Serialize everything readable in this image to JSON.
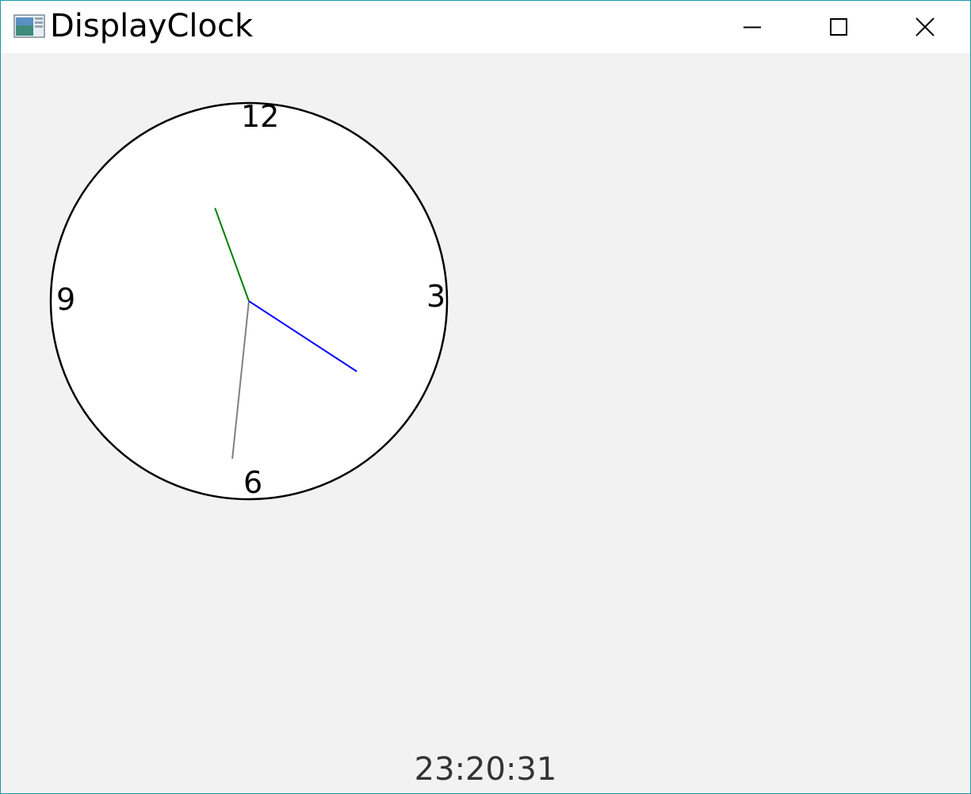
{
  "window": {
    "title": "DisplayClock",
    "frame_color": "#1c97a8"
  },
  "titlebar_buttons": {
    "minimize_icon": "minimize-icon",
    "maximize_icon": "maximize-icon",
    "close_icon": "close-icon"
  },
  "clock": {
    "numbers": {
      "twelve": "12",
      "three": "3",
      "six": "6",
      "nine": "9"
    },
    "hour": 23,
    "minute": 20,
    "second": 31,
    "hour_hand_color": "#008000",
    "minute_hand_color": "#0000ff",
    "second_hand_color": "#808080",
    "face_color": "#ffffff",
    "rim_color": "#000000"
  },
  "digital_time": "23:20:31"
}
